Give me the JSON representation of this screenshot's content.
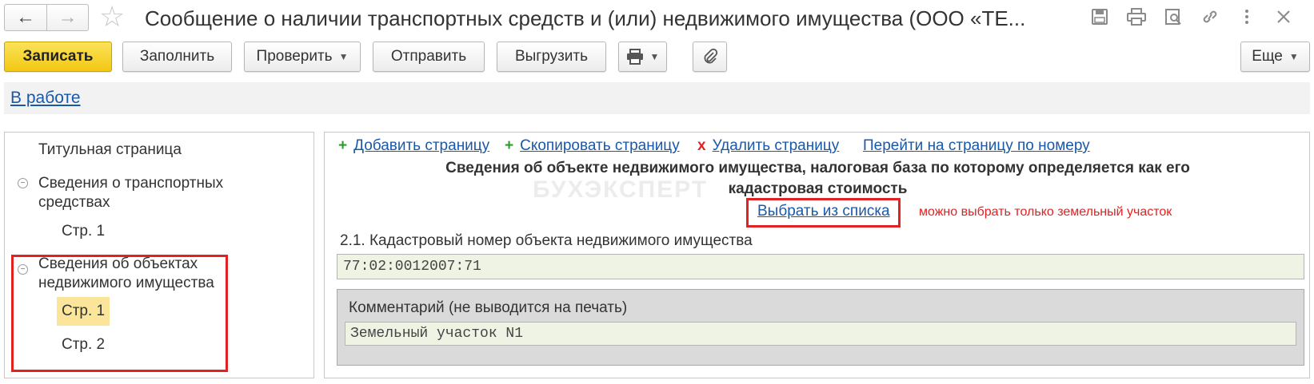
{
  "window": {
    "title": "Сообщение о наличии транспортных средств и (или) недвижимого имущества (ООО «ТЕ...",
    "nav": {
      "back_icon": "←",
      "forward_icon": "→",
      "star_icon": "☆"
    },
    "title_icons": [
      {
        "name": "save-icon",
        "glyph": "🖫"
      },
      {
        "name": "print-icon",
        "glyph": "⎙"
      },
      {
        "name": "preview-icon",
        "glyph": "🔍"
      },
      {
        "name": "link-icon",
        "glyph": "🔗"
      },
      {
        "name": "more-icon",
        "glyph": "⋮"
      },
      {
        "name": "close-icon",
        "glyph": "✕"
      }
    ]
  },
  "toolbar": {
    "save": "Записать",
    "fill": "Заполнить",
    "check": "Проверить",
    "send": "Отправить",
    "export": "Выгрузить",
    "print_icon": "🖶",
    "attach_icon": "📎",
    "more": "Еще"
  },
  "status": {
    "link": "В работе"
  },
  "tree": {
    "title_page": "Титульная страница",
    "transport": {
      "label_line1": "Сведения о транспортных",
      "label_line2": "средствах",
      "pages": [
        "Стр. 1"
      ]
    },
    "property": {
      "label_line1": "Сведения об объектах",
      "label_line2": "недвижимого имущества",
      "pages": [
        "Стр. 1",
        "Стр. 2"
      ]
    }
  },
  "page_commands": {
    "add": "Добавить страницу",
    "copy": "Скопировать страницу",
    "delete": "Удалить страницу",
    "goto": "Перейти на страницу по номеру"
  },
  "section": {
    "title_line1": "Сведения об объекте недвижимого имущества, налоговая база по которому определяется как его",
    "title_line2": "кадастровая стоимость",
    "watermark": "БУХЭКСПЕРТ",
    "pick_link": "Выбрать из списка",
    "note": "можно выбрать только земельный участок",
    "cadastral_label": "2.1. Кадастровый номер объекта недвижимого имущества",
    "cadastral_value": "77:02:0012007:71",
    "comment_label": "Комментарий (не выводится на печать)",
    "comment_value": "Земельный участок N1"
  },
  "colors": {
    "accent": "#f2c812",
    "link": "#1a58a8",
    "highlight": "#fbe59a",
    "annotation": "#e22222"
  }
}
